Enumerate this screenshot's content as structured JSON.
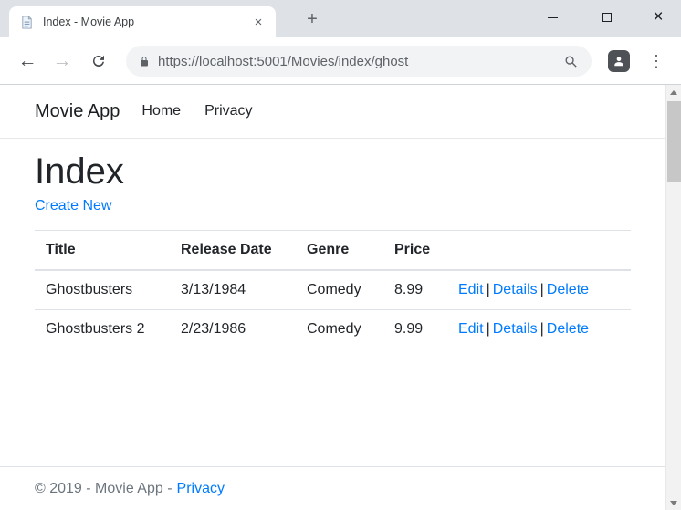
{
  "browser": {
    "tab_title": "Index - Movie App",
    "url": "https://localhost:5001/Movies/index/ghost",
    "icons": {
      "back": "←",
      "forward": "→",
      "new_tab": "+",
      "tab_close": "×",
      "window_close": "×",
      "menu_dots": "⋮"
    }
  },
  "site": {
    "navbar": {
      "brand": "Movie App",
      "links": [
        "Home",
        "Privacy"
      ]
    },
    "heading": "Index",
    "create_link": "Create New",
    "table": {
      "headers": [
        "Title",
        "Release Date",
        "Genre",
        "Price"
      ],
      "separator": "|",
      "rows": [
        {
          "title": "Ghostbusters",
          "release_date": "3/13/1984",
          "genre": "Comedy",
          "price": "8.99",
          "actions": [
            "Edit",
            "Details",
            "Delete"
          ]
        },
        {
          "title": "Ghostbusters 2",
          "release_date": "2/23/1986",
          "genre": "Comedy",
          "price": "9.99",
          "actions": [
            "Edit",
            "Details",
            "Delete"
          ]
        }
      ]
    },
    "footer": {
      "text": "© 2019 - Movie App -",
      "privacy": "Privacy"
    }
  },
  "colors": {
    "link": "#007bff",
    "text": "#212529",
    "muted": "#6c757d",
    "table_border": "#dee2e6",
    "chrome_bg": "#dee1e6",
    "omnibox_bg": "#f1f3f4"
  }
}
